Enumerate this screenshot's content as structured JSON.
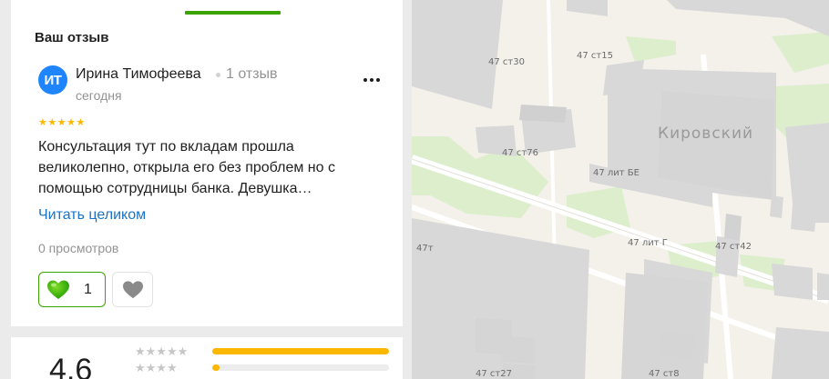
{
  "panel": {
    "section_title": "Ваш отзыв",
    "review": {
      "avatar_initials": "ИТ",
      "author": "Ирина Тимофеева",
      "author_reviews": "1 отзыв",
      "date": "сегодня",
      "stars": "★★★★★",
      "rating": 5,
      "text": "Консультация тут по вкладам прошла великолепно, открыла его без проблем но с помощью сотрудницы банка. Девушка…",
      "read_more": "Читать целиком",
      "views": "0 просмотров",
      "likes": "1",
      "like_icon": "green-heart-icon",
      "dislike_icon": "gray-heart-icon"
    },
    "summary": {
      "rating_value": "4,6",
      "distribution": [
        {
          "stars": "★★★★★",
          "fill": 1.0
        },
        {
          "stars": "★★★★",
          "fill": 0.04
        }
      ]
    }
  },
  "map": {
    "district": "Кировский",
    "labels": [
      "47 ст30",
      "47 ст15",
      "47 ст76",
      "47 лит БЕ",
      "47т",
      "47 лит Г",
      "47 ст42",
      "47 ст27",
      "47 ст8"
    ]
  }
}
